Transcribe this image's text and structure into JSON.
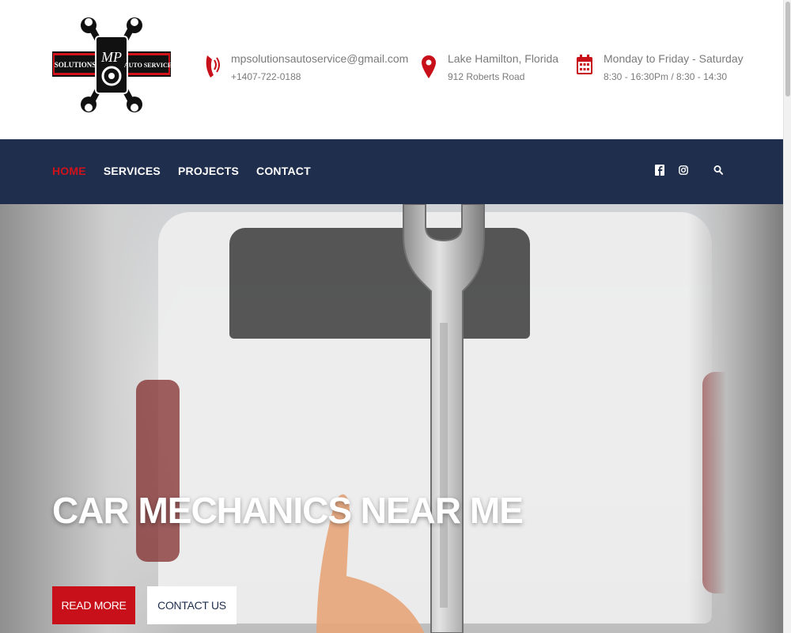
{
  "header": {
    "logo": {
      "text_left": "SOLUTIONS",
      "text_right": "AUTO SERVICE",
      "monogram": "MP"
    },
    "contact": {
      "icon": "phone-icon",
      "email": "mpsolutionsautoservice@gmail.com",
      "phone": "+1407-722-0188"
    },
    "location": {
      "icon": "map-pin-icon",
      "city": "Lake Hamilton, Florida",
      "street": "912 Roberts Road"
    },
    "hours": {
      "icon": "calendar-icon",
      "days": "Monday to Friday - Saturday",
      "times": "8:30 - 16:30Pm / 8:30 - 14:30"
    }
  },
  "nav": {
    "items": [
      {
        "label": "HOME",
        "active": true
      },
      {
        "label": "SERVICES",
        "active": false
      },
      {
        "label": "PROJECTS",
        "active": false
      },
      {
        "label": "CONTACT",
        "active": false
      }
    ],
    "icons": [
      "facebook-icon",
      "instagram-icon",
      "search-icon"
    ]
  },
  "hero": {
    "title": "CAR MECHANICS NEAR ME",
    "buttons": {
      "read_more": "READ MORE",
      "contact_us": "CONTACT US"
    }
  },
  "colors": {
    "accent": "#c8101a",
    "nav_bg": "#1f2e4d",
    "text_muted": "#7a7a7a"
  }
}
